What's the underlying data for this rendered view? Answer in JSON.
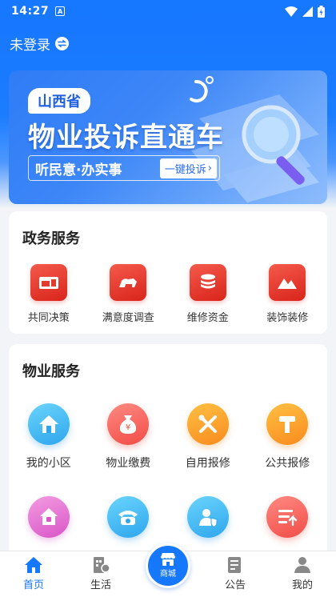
{
  "status_bar": {
    "time": "14:27",
    "notification_badge": "A"
  },
  "header": {
    "login_text": "未登录"
  },
  "banner": {
    "province": "山西省",
    "headline": "物业投诉直通车",
    "slogan": "听民意·办实事",
    "cta": "一键投诉"
  },
  "gov_services": {
    "title": "政务服务",
    "items": [
      {
        "label": "共同决策",
        "icon": "decision-icon"
      },
      {
        "label": "满意度调查",
        "icon": "survey-icon"
      },
      {
        "label": "维修资金",
        "icon": "coins-icon"
      },
      {
        "label": "装饰装修",
        "icon": "mountain-icon"
      }
    ]
  },
  "property_services": {
    "title": "物业服务",
    "items": [
      {
        "label": "我的小区",
        "icon": "home-icon",
        "color": "blue"
      },
      {
        "label": "物业缴费",
        "icon": "money-bag-icon",
        "color": "red"
      },
      {
        "label": "自用报修",
        "icon": "tools-icon",
        "color": "orange"
      },
      {
        "label": "公共报修",
        "icon": "hammer-icon",
        "color": "orange"
      },
      {
        "label": "",
        "icon": "house-lock-icon",
        "color": "pink"
      },
      {
        "label": "",
        "icon": "phone-icon",
        "color": "blue"
      },
      {
        "label": "",
        "icon": "user-shield-icon",
        "color": "blue"
      },
      {
        "label": "",
        "icon": "list-upload-icon",
        "color": "red"
      }
    ]
  },
  "tabbar": {
    "items": [
      {
        "label": "首页",
        "icon": "home-tab-icon",
        "active": true
      },
      {
        "label": "生活",
        "icon": "life-tab-icon",
        "active": false
      },
      {
        "label": "商城",
        "icon": "store-tab-icon",
        "active": false
      },
      {
        "label": "公告",
        "icon": "notice-tab-icon",
        "active": false
      },
      {
        "label": "我的",
        "icon": "profile-tab-icon",
        "active": false
      }
    ]
  },
  "colors": {
    "brand_blue": "#1677ff",
    "gov_icon_red": "#e33a2e"
  }
}
